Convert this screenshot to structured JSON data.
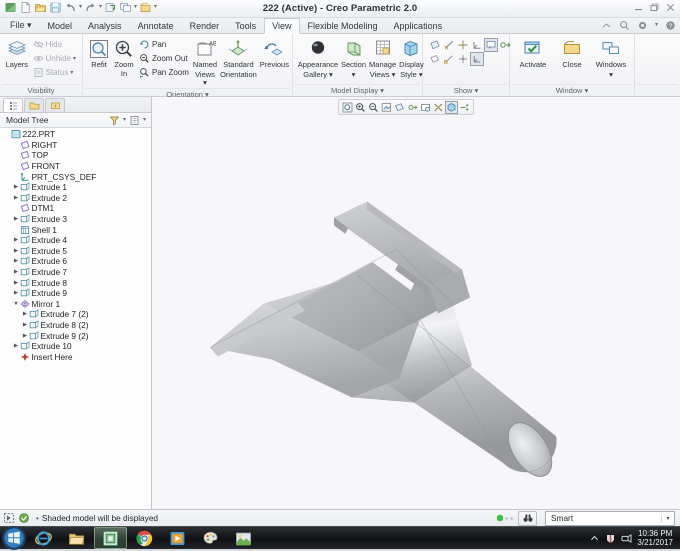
{
  "window": {
    "title": "222 (Active) - Creo Parametric 2.0",
    "quick_access": [
      {
        "name": "app-menu-icon",
        "label": "Creo"
      },
      {
        "name": "new-icon",
        "label": "New"
      },
      {
        "name": "open-icon",
        "label": "Open"
      },
      {
        "name": "save-icon",
        "label": "Save"
      },
      {
        "name": "undo-icon",
        "label": "Undo"
      },
      {
        "name": "redo-icon",
        "label": "Redo"
      },
      {
        "name": "regenerate-icon",
        "label": "Regenerate"
      },
      {
        "name": "window-switch-icon",
        "label": "Switch Window"
      },
      {
        "name": "close-window-icon",
        "label": "Close Window"
      }
    ],
    "controls": [
      "Minimize",
      "Restore",
      "Close"
    ]
  },
  "tabs": [
    {
      "label": "File ▾",
      "active": false
    },
    {
      "label": "Model",
      "active": false
    },
    {
      "label": "Analysis",
      "active": false
    },
    {
      "label": "Annotate",
      "active": false
    },
    {
      "label": "Render",
      "active": false
    },
    {
      "label": "Tools",
      "active": false
    },
    {
      "label": "View",
      "active": true
    },
    {
      "label": "Flexible Modeling",
      "active": false
    },
    {
      "label": "Applications",
      "active": false
    }
  ],
  "tab_tools": [
    "collapse-ribbon",
    "search",
    "settings",
    "help"
  ],
  "ribbon": {
    "groups": [
      {
        "label": "Visibility",
        "big": [
          {
            "label_line1": "Layers",
            "label_line2": "",
            "icon": "layers-icon"
          }
        ],
        "small": [
          {
            "label": "Hide",
            "icon": "hide-icon",
            "dim": true,
            "caret": false
          },
          {
            "label": "Unhide",
            "icon": "unhide-icon",
            "dim": true,
            "caret": true
          },
          {
            "label": "Status",
            "icon": "status-icon",
            "dim": true,
            "caret": true
          }
        ]
      },
      {
        "label": "Orientation ▾",
        "big": [
          {
            "label_line1": "Refit",
            "label_line2": "",
            "icon": "refit-icon"
          },
          {
            "label_line1": "Zoom In",
            "label_line2": "",
            "icon": "zoom-in-icon"
          }
        ],
        "small": [
          {
            "label": "Pan",
            "icon": "pan-icon",
            "dim": false,
            "caret": false
          },
          {
            "label": "Zoom Out",
            "icon": "zoom-out-icon",
            "dim": false,
            "caret": false
          },
          {
            "label": "Pan Zoom",
            "icon": "pan-zoom-icon",
            "dim": false,
            "caret": false
          }
        ],
        "big2": [
          {
            "label_line1": "Named",
            "label_line2": "Views ▾",
            "icon": "named-views-icon"
          },
          {
            "label_line1": "Standard",
            "label_line2": "Orientation",
            "icon": "standard-orientation-icon"
          },
          {
            "label_line1": "Previous",
            "label_line2": "",
            "icon": "previous-view-icon"
          }
        ]
      },
      {
        "label": "Model Display ▾",
        "big": [
          {
            "label_line1": "Appearance",
            "label_line2": "Gallery ▾",
            "icon": "appearance-gallery-icon"
          },
          {
            "label_line1": "Section",
            "label_line2": "▾",
            "icon": "section-icon"
          },
          {
            "label_line1": "Manage",
            "label_line2": "Views ▾",
            "icon": "manage-views-icon"
          },
          {
            "label_line1": "Display",
            "label_line2": "Style ▾",
            "icon": "display-style-icon"
          }
        ]
      },
      {
        "label": "Show ▾",
        "row1": [
          "datum-plane-icon",
          "datum-axis-icon",
          "datum-point-icon",
          "coord-sys-icon",
          "annotation-icon",
          "spin-center-icon"
        ],
        "row2": [
          "plane-tag-icon",
          "axis-tag-icon",
          "point-tag-icon",
          "csys-tag-icon"
        ]
      },
      {
        "label": "Window ▾",
        "big": [
          {
            "label_line1": "Activate",
            "label_line2": "",
            "icon": "activate-icon"
          },
          {
            "label_line1": "Close",
            "label_line2": "",
            "icon": "close-window-icon"
          },
          {
            "label_line1": "Windows",
            "label_line2": "▾",
            "icon": "windows-icon"
          }
        ]
      }
    ]
  },
  "navigator": {
    "tabs": [
      "model-tree-tab",
      "folder-browser-tab",
      "favorites-tab"
    ],
    "title": "Model Tree",
    "header_icons": [
      "filter-icon",
      "settings-icon"
    ],
    "tree": [
      {
        "label": "222.PRT",
        "indent": 0,
        "arrow": "",
        "icon": "part-icon"
      },
      {
        "label": "RIGHT",
        "indent": 1,
        "arrow": "",
        "icon": "datum-plane-icon"
      },
      {
        "label": "TOP",
        "indent": 1,
        "arrow": "",
        "icon": "datum-plane-icon"
      },
      {
        "label": "FRONT",
        "indent": 1,
        "arrow": "",
        "icon": "datum-plane-icon"
      },
      {
        "label": "PRT_CSYS_DEF",
        "indent": 1,
        "arrow": "",
        "icon": "csys-icon"
      },
      {
        "label": "Extrude 1",
        "indent": 1,
        "arrow": "▶",
        "icon": "extrude-icon"
      },
      {
        "label": "Extrude 2",
        "indent": 1,
        "arrow": "▶",
        "icon": "extrude-icon"
      },
      {
        "label": "DTM1",
        "indent": 1,
        "arrow": "",
        "icon": "datum-plane-icon"
      },
      {
        "label": "Extrude 3",
        "indent": 1,
        "arrow": "▶",
        "icon": "extrude-icon"
      },
      {
        "label": "Shell 1",
        "indent": 1,
        "arrow": "",
        "icon": "shell-icon"
      },
      {
        "label": "Extrude 4",
        "indent": 1,
        "arrow": "▶",
        "icon": "extrude-icon"
      },
      {
        "label": "Extrude 5",
        "indent": 1,
        "arrow": "▶",
        "icon": "extrude-icon"
      },
      {
        "label": "Extrude 6",
        "indent": 1,
        "arrow": "▶",
        "icon": "extrude-icon"
      },
      {
        "label": "Extrude 7",
        "indent": 1,
        "arrow": "▶",
        "icon": "extrude-icon"
      },
      {
        "label": "Extrude 8",
        "indent": 1,
        "arrow": "▶",
        "icon": "extrude-icon"
      },
      {
        "label": "Extrude 9",
        "indent": 1,
        "arrow": "▶",
        "icon": "extrude-icon"
      },
      {
        "label": "Mirror 1",
        "indent": 1,
        "arrow": "▼",
        "icon": "mirror-icon"
      },
      {
        "label": "Extrude 7 (2)",
        "indent": 2,
        "arrow": "▶",
        "icon": "extrude-icon"
      },
      {
        "label": "Extrude 8 (2)",
        "indent": 2,
        "arrow": "▶",
        "icon": "extrude-icon"
      },
      {
        "label": "Extrude 9 (2)",
        "indent": 2,
        "arrow": "▶",
        "icon": "extrude-icon"
      },
      {
        "label": "Extrude 10",
        "indent": 1,
        "arrow": "▶",
        "icon": "extrude-icon"
      },
      {
        "label": "Insert Here",
        "indent": 1,
        "arrow": "",
        "icon": "insert-here-icon"
      }
    ]
  },
  "graphics_toolbar": [
    {
      "name": "refit-icon",
      "selected": false
    },
    {
      "name": "zoom-in-icon",
      "selected": false
    },
    {
      "name": "zoom-out-icon",
      "selected": false
    },
    {
      "name": "repaint-icon",
      "selected": false
    },
    {
      "name": "datum-display-icon",
      "selected": false
    },
    {
      "name": "spin-center-icon",
      "selected": false
    },
    {
      "name": "saved-views-icon",
      "selected": false
    },
    {
      "name": "view-manager-icon",
      "selected": false
    },
    {
      "name": "display-style-icon",
      "selected": true
    },
    {
      "name": "perspective-icon",
      "selected": false
    }
  ],
  "viewport": {
    "background": "#f7f7f9",
    "model_name": "222.PRT",
    "model_color": "#b6b8ba",
    "description": "Shaded 3D nozzle part"
  },
  "status": {
    "icons": [
      "selection-icon",
      "filter-icon"
    ],
    "message": "Shaded model will be displayed",
    "find_label": "Search",
    "selection_filter": "Smart"
  },
  "taskbar": {
    "items": [
      {
        "name": "start-orb",
        "label": "Start"
      },
      {
        "name": "internet-explorer-icon",
        "label": "Internet Explorer"
      },
      {
        "name": "file-explorer-icon",
        "label": "Windows Explorer"
      },
      {
        "name": "creo-parametric-icon",
        "label": "Creo Parametric",
        "active": true
      },
      {
        "name": "google-chrome-icon",
        "label": "Google Chrome"
      },
      {
        "name": "media-player-icon",
        "label": "Media Player"
      },
      {
        "name": "paint-icon",
        "label": "Paint"
      },
      {
        "name": "photo-viewer-icon",
        "label": "Photo Viewer"
      }
    ],
    "tray": [
      "show-hidden-icons",
      "security-icon",
      "network-icon"
    ],
    "clock_time": "10:36 PM",
    "clock_date": "3/21/2017"
  }
}
